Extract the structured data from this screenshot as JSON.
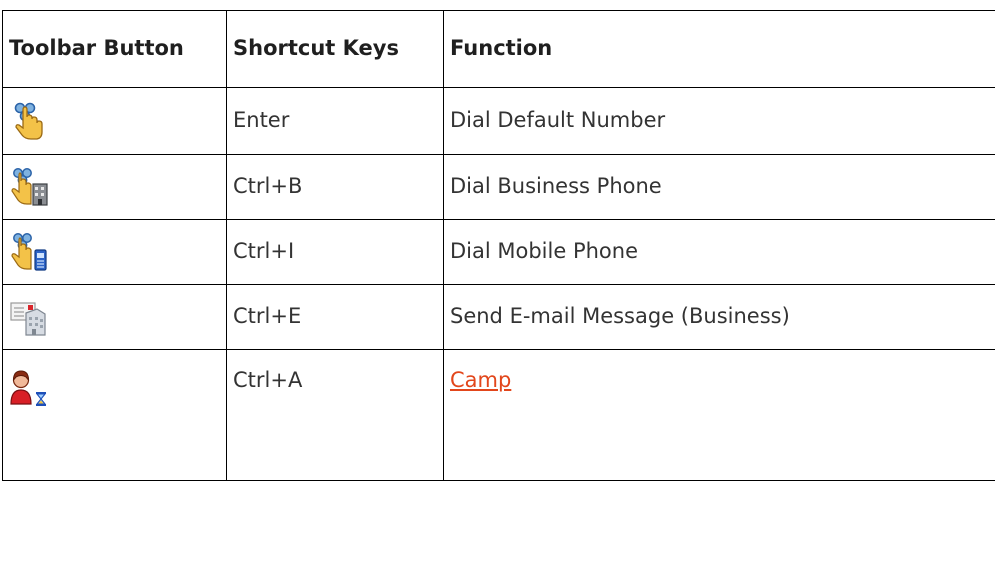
{
  "table": {
    "headers": [
      "Toolbar Button",
      "Shortcut Keys",
      "Function"
    ],
    "rows": [
      {
        "icon": "dial-default-icon",
        "shortcut": "Enter",
        "function": "Dial Default Number",
        "function_is_link": false
      },
      {
        "icon": "dial-business-icon",
        "shortcut": "Ctrl+B",
        "function": "Dial Business Phone",
        "function_is_link": false
      },
      {
        "icon": "dial-mobile-icon",
        "shortcut": "Ctrl+I",
        "function": "Dial Mobile Phone",
        "function_is_link": false
      },
      {
        "icon": "email-business-icon",
        "shortcut": "Ctrl+E",
        "function": "Send E-mail Message (Business)",
        "function_is_link": false
      },
      {
        "icon": "user-hourglass-icon",
        "shortcut": "Ctrl+A",
        "function": "Camp",
        "function_is_link": true
      }
    ]
  },
  "colors": {
    "link": "#e2461b",
    "border": "#000000",
    "text": "#333333"
  }
}
